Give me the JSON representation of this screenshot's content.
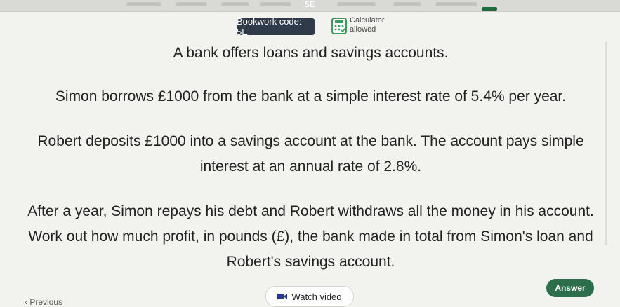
{
  "header": {
    "nav_label": "5E",
    "bookwork_label": "Bookwork code: 5E",
    "calculator_line1": "Calculator",
    "calculator_line2": "allowed"
  },
  "question": {
    "p1": "A bank offers loans and savings accounts.",
    "p2": "Simon borrows £1000 from the bank at a simple interest rate of 5.4% per year.",
    "p3": "Robert deposits £1000 into a savings account at the bank. The account pays simple interest at an annual rate of 2.8%.",
    "p4": "After a year, Simon repays his debt and Robert withdraws all the money in his account. Work out how much profit, in pounds (£), the bank made in total from Simon's loan and Robert's savings account."
  },
  "footer": {
    "previous_label": "‹ Previous",
    "watch_label": "Watch video",
    "answer_label": "Answer"
  },
  "colors": {
    "answer_green": "#2c6e4b",
    "bookwork_bg": "#2f3a4a",
    "calc_icon_green": "#3c9a5f"
  },
  "icons": [
    "calculator-icon",
    "video-icon"
  ]
}
